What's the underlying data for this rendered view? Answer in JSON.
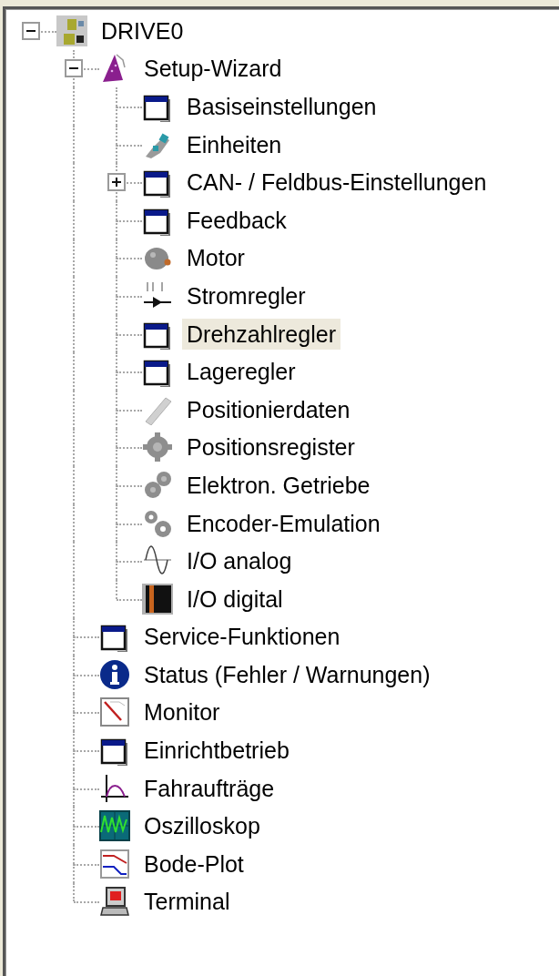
{
  "tree": [
    {
      "label": "DRIVE0",
      "kind": "drive",
      "selected": false,
      "expanded": true,
      "children": [
        {
          "label": "Setup-Wizard",
          "kind": "wizard",
          "selected": false,
          "expanded": true,
          "children": [
            {
              "label": "Basiseinstellungen",
              "kind": "window",
              "selected": false
            },
            {
              "label": "Einheiten",
              "kind": "plug",
              "selected": false
            },
            {
              "label": "CAN- / Feldbus-Einstellungen",
              "kind": "window",
              "selected": false,
              "expanded": false
            },
            {
              "label": "Feedback",
              "kind": "window",
              "selected": false
            },
            {
              "label": "Motor",
              "kind": "motor",
              "selected": false
            },
            {
              "label": "Stromregler",
              "kind": "current",
              "selected": false
            },
            {
              "label": "Drehzahlregler",
              "kind": "window",
              "selected": true
            },
            {
              "label": "Lageregler",
              "kind": "window",
              "selected": false
            },
            {
              "label": "Positionierdaten",
              "kind": "ruler",
              "selected": false
            },
            {
              "label": "Positionsregister",
              "kind": "gear",
              "selected": false
            },
            {
              "label": "Elektron. Getriebe",
              "kind": "gears",
              "selected": false
            },
            {
              "label": "Encoder-Emulation",
              "kind": "gears2",
              "selected": false
            },
            {
              "label": "I/O analog",
              "kind": "analog",
              "selected": false
            },
            {
              "label": "I/O digital",
              "kind": "digital",
              "selected": false
            }
          ]
        },
        {
          "label": "Service-Funktionen",
          "kind": "window",
          "selected": false
        },
        {
          "label": "Status (Fehler / Warnungen)",
          "kind": "info",
          "selected": false
        },
        {
          "label": "Monitor",
          "kind": "monitor",
          "selected": false
        },
        {
          "label": "Einrichtbetrieb",
          "kind": "window",
          "selected": false
        },
        {
          "label": "Fahraufträge",
          "kind": "profile",
          "selected": false
        },
        {
          "label": "Oszilloskop",
          "kind": "scope",
          "selected": false
        },
        {
          "label": "Bode-Plot",
          "kind": "bode",
          "selected": false
        },
        {
          "label": "Terminal",
          "kind": "terminal",
          "selected": false
        }
      ]
    }
  ]
}
